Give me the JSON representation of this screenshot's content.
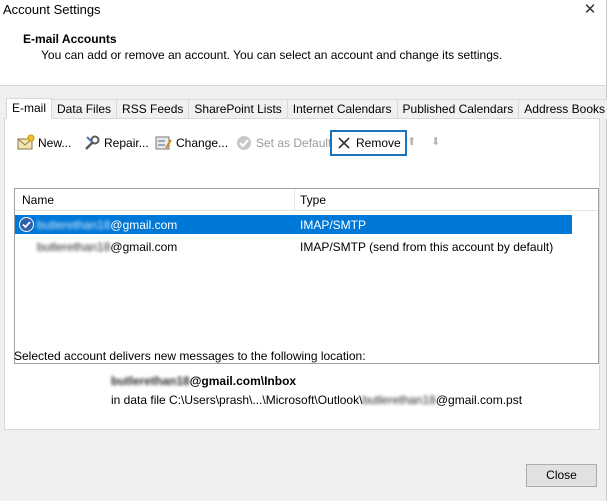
{
  "window": {
    "title": "Account Settings",
    "close_glyph": "✕"
  },
  "header": {
    "title": "E-mail Accounts",
    "description": "You can add or remove an account. You can select an account and change its settings."
  },
  "tabs": [
    {
      "label": "E-mail",
      "active": true
    },
    {
      "label": "Data Files"
    },
    {
      "label": "RSS Feeds"
    },
    {
      "label": "SharePoint Lists"
    },
    {
      "label": "Internet Calendars"
    },
    {
      "label": "Published Calendars"
    },
    {
      "label": "Address Books"
    }
  ],
  "toolbar": {
    "new_label": "New...",
    "repair_label": "Repair...",
    "change_label": "Change...",
    "set_default_label": "Set as Default",
    "remove_label": "Remove",
    "up_glyph": "⬆",
    "down_glyph": "⬇"
  },
  "accounts": {
    "columns": [
      "Name",
      "Type"
    ],
    "rows": [
      {
        "name_blurred": "butlerethan18",
        "name_domain": "@gmail.com",
        "type": "IMAP/SMTP",
        "selected": true
      },
      {
        "name_blurred": "butlerethan18",
        "name_domain": "@gmail.com",
        "type": "IMAP/SMTP (send from this account by default)",
        "selected": false
      }
    ]
  },
  "delivery": {
    "label": "Selected account delivers new messages to the following location:",
    "mailbox_blurred": "butlerethan18",
    "mailbox_rest": "@gmail.com\\Inbox",
    "file_prefix": "in data file C:\\Users\\prash\\...\\Microsoft\\Outlook\\",
    "file_blurred": "butlerethan18",
    "file_suffix": "@gmail.com.pst"
  },
  "footer": {
    "close_label": "Close"
  },
  "colors": {
    "selection": "#0078d7",
    "highlight_border": "#1c75bc"
  }
}
